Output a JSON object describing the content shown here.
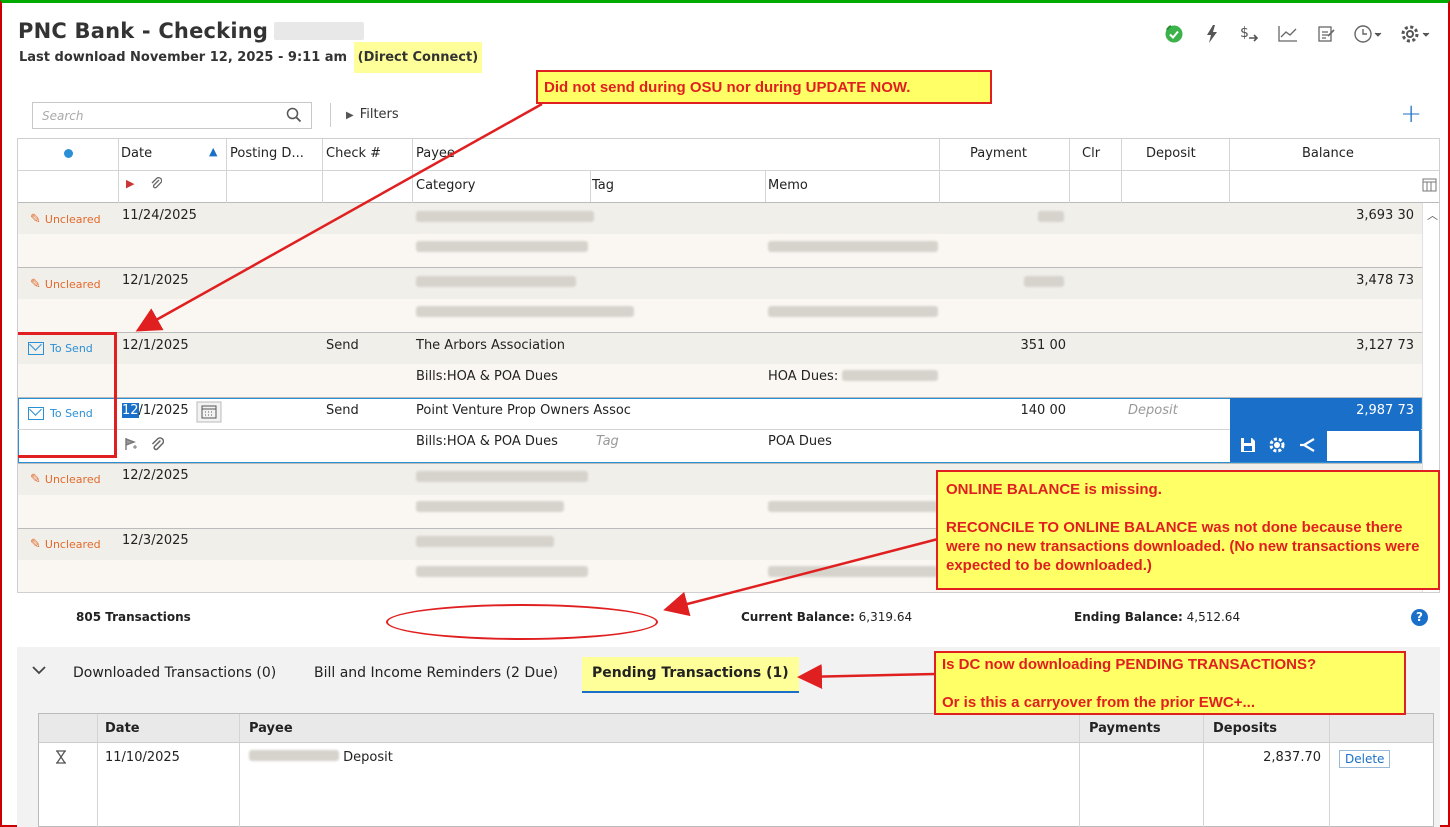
{
  "header": {
    "title": "PNC Bank - Checking",
    "subtitle_prefix": "Last download November 12, 2025 - 9:11 am",
    "subtitle_method": "(Direct Connect)"
  },
  "toolbar": {
    "icons": [
      "sync-check-icon",
      "lightning-icon",
      "dollar-transfer-icon",
      "chart-icon",
      "notes-icon",
      "clock-dropdown-icon",
      "gear-dropdown-icon"
    ]
  },
  "search": {
    "placeholder": "Search"
  },
  "filters": {
    "label": "Filters"
  },
  "columns": {
    "date": "Date",
    "posting": "Posting D...",
    "check": "Check #",
    "payee": "Payee",
    "payment": "Payment",
    "clr": "Clr",
    "deposit": "Deposit",
    "balance": "Balance",
    "category": "Category",
    "tag": "Tag",
    "memo": "Memo"
  },
  "transactions": [
    {
      "status": "Uncleared",
      "date": "11/24/2025",
      "check": "",
      "payee": "",
      "category": "",
      "memo": "",
      "payment": "",
      "balance": "3,693 30"
    },
    {
      "status": "Uncleared",
      "date": "12/1/2025",
      "check": "",
      "payee": "",
      "category": "",
      "memo": "",
      "payment": "",
      "balance": "3,478 73"
    },
    {
      "status": "To Send",
      "date": "12/1/2025",
      "check": "Send",
      "payee": "The Arbors Association",
      "category": "Bills:HOA & POA Dues",
      "memo": "HOA Dues:",
      "payment": "351 00",
      "balance": "3,127 73"
    },
    {
      "status": "To Send",
      "date_sel": "12",
      "date_rest": "/1/2025",
      "check": "Send",
      "payee": "Point Venture Prop Owners Assoc",
      "category": "Bills:HOA & POA Dues",
      "tag_placeholder": "Tag",
      "memo": "POA Dues",
      "payment": "140 00",
      "deposit_placeholder": "Deposit",
      "balance": "2,987 73"
    },
    {
      "status": "Uncleared",
      "date": "12/2/2025",
      "check": "",
      "payee": "",
      "category": "",
      "memo": "",
      "payment": "",
      "balance": ""
    },
    {
      "status": "Uncleared",
      "date": "12/3/2025",
      "check": "",
      "payee": "",
      "category": "",
      "memo": "",
      "payment": "",
      "balance": ""
    }
  ],
  "footer": {
    "count": "805 Transactions",
    "current_label": "Current Balance:",
    "current_value": "6,319.64",
    "ending_label": "Ending Balance:",
    "ending_value": "4,512.64"
  },
  "tabs": [
    {
      "label": "Downloaded Transactions (0)"
    },
    {
      "label": "Bill and Income Reminders (2 Due)"
    },
    {
      "label": "Pending Transactions (1)"
    }
  ],
  "pending": {
    "headers": {
      "date": "Date",
      "payee": "Payee",
      "payments": "Payments",
      "deposits": "Deposits"
    },
    "rows": [
      {
        "date": "11/10/2025",
        "payee": "Deposit",
        "deposit": "2,837.70",
        "action": "Delete"
      }
    ]
  },
  "annotations": {
    "a1": "Did not send during OSU nor during UPDATE NOW.",
    "a2": "ONLINE BALANCE is missing.\n\nRECONCILE TO ONLINE BALANCE was not done because there were no new transactions downloaded.  (No new transactions were expected to be downloaded.)",
    "a3": "Is DC now downloading PENDING TRANSACTIONS?\n\nOr is this a carryover from the prior EWC+..."
  },
  "colors": {
    "accent": "#1a6fc8",
    "uncleared": "#e26a2c",
    "to_send": "#2b8fd6",
    "annotation_fill": "#ffff66",
    "annotation_red": "#e02020"
  }
}
